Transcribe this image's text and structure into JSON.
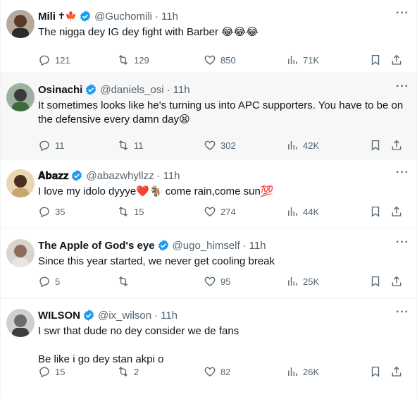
{
  "tweets": [
    {
      "name": "Mili",
      "name_emoji": "✝🍁",
      "handle": "@Guchomili",
      "time": "11h",
      "text": "The nigga dey IG dey fight with Barber 😂😂😂",
      "replies": "121",
      "retweets": "129",
      "likes": "850",
      "views": "71K",
      "avatar_color": "#5a3b2a"
    },
    {
      "name": "Osinachi",
      "name_emoji": "",
      "handle": "@daniels_osi",
      "time": "11h",
      "text": "It sometimes looks like he's turning us into APC supporters. You have to be on the defensive every damn day😫",
      "replies": "11",
      "retweets": "11",
      "likes": "302",
      "views": "42K",
      "avatar_color": "#3c3c3c"
    },
    {
      "name": "𝐀𝐛𝐚𝐳𝐳",
      "name_emoji": "",
      "handle": "@abazwhyllzz",
      "time": "11h",
      "text": "I love my idolo dyyye❤️🐐 come rain,come sun💯",
      "replies": "35",
      "retweets": "15",
      "likes": "274",
      "views": "44K",
      "avatar_color": "#c9a66b"
    },
    {
      "name": "The Apple of God's eye",
      "name_emoji": "",
      "handle": "@ugo_himself",
      "time": "11h",
      "text": "Since this year started, we never get cooling break",
      "replies": "5",
      "retweets": "",
      "likes": "95",
      "views": "25K",
      "avatar_color": "#8a6d5a"
    },
    {
      "name": "WILSON",
      "name_emoji": "",
      "handle": "@ix_wilson",
      "time": "11h",
      "text": "I swr that dude no dey consider we de fans\n\nBe like i go dey stan akpi o",
      "replies": "15",
      "retweets": "2",
      "likes": "82",
      "views": "26K",
      "avatar_color": "#6b6b6b"
    }
  ],
  "colors": {
    "verified": "#1d9bf0",
    "muted": "#536471",
    "text": "#0f1419",
    "divider": "#eff3f4",
    "highlight_bg": "#f7f7f7"
  },
  "icons": {
    "reply": "reply-icon",
    "retweet": "retweet-icon",
    "like": "heart-icon",
    "views": "views-icon",
    "bookmark": "bookmark-icon",
    "share": "share-icon",
    "more": "more-icon",
    "verified": "verified-badge-icon"
  }
}
